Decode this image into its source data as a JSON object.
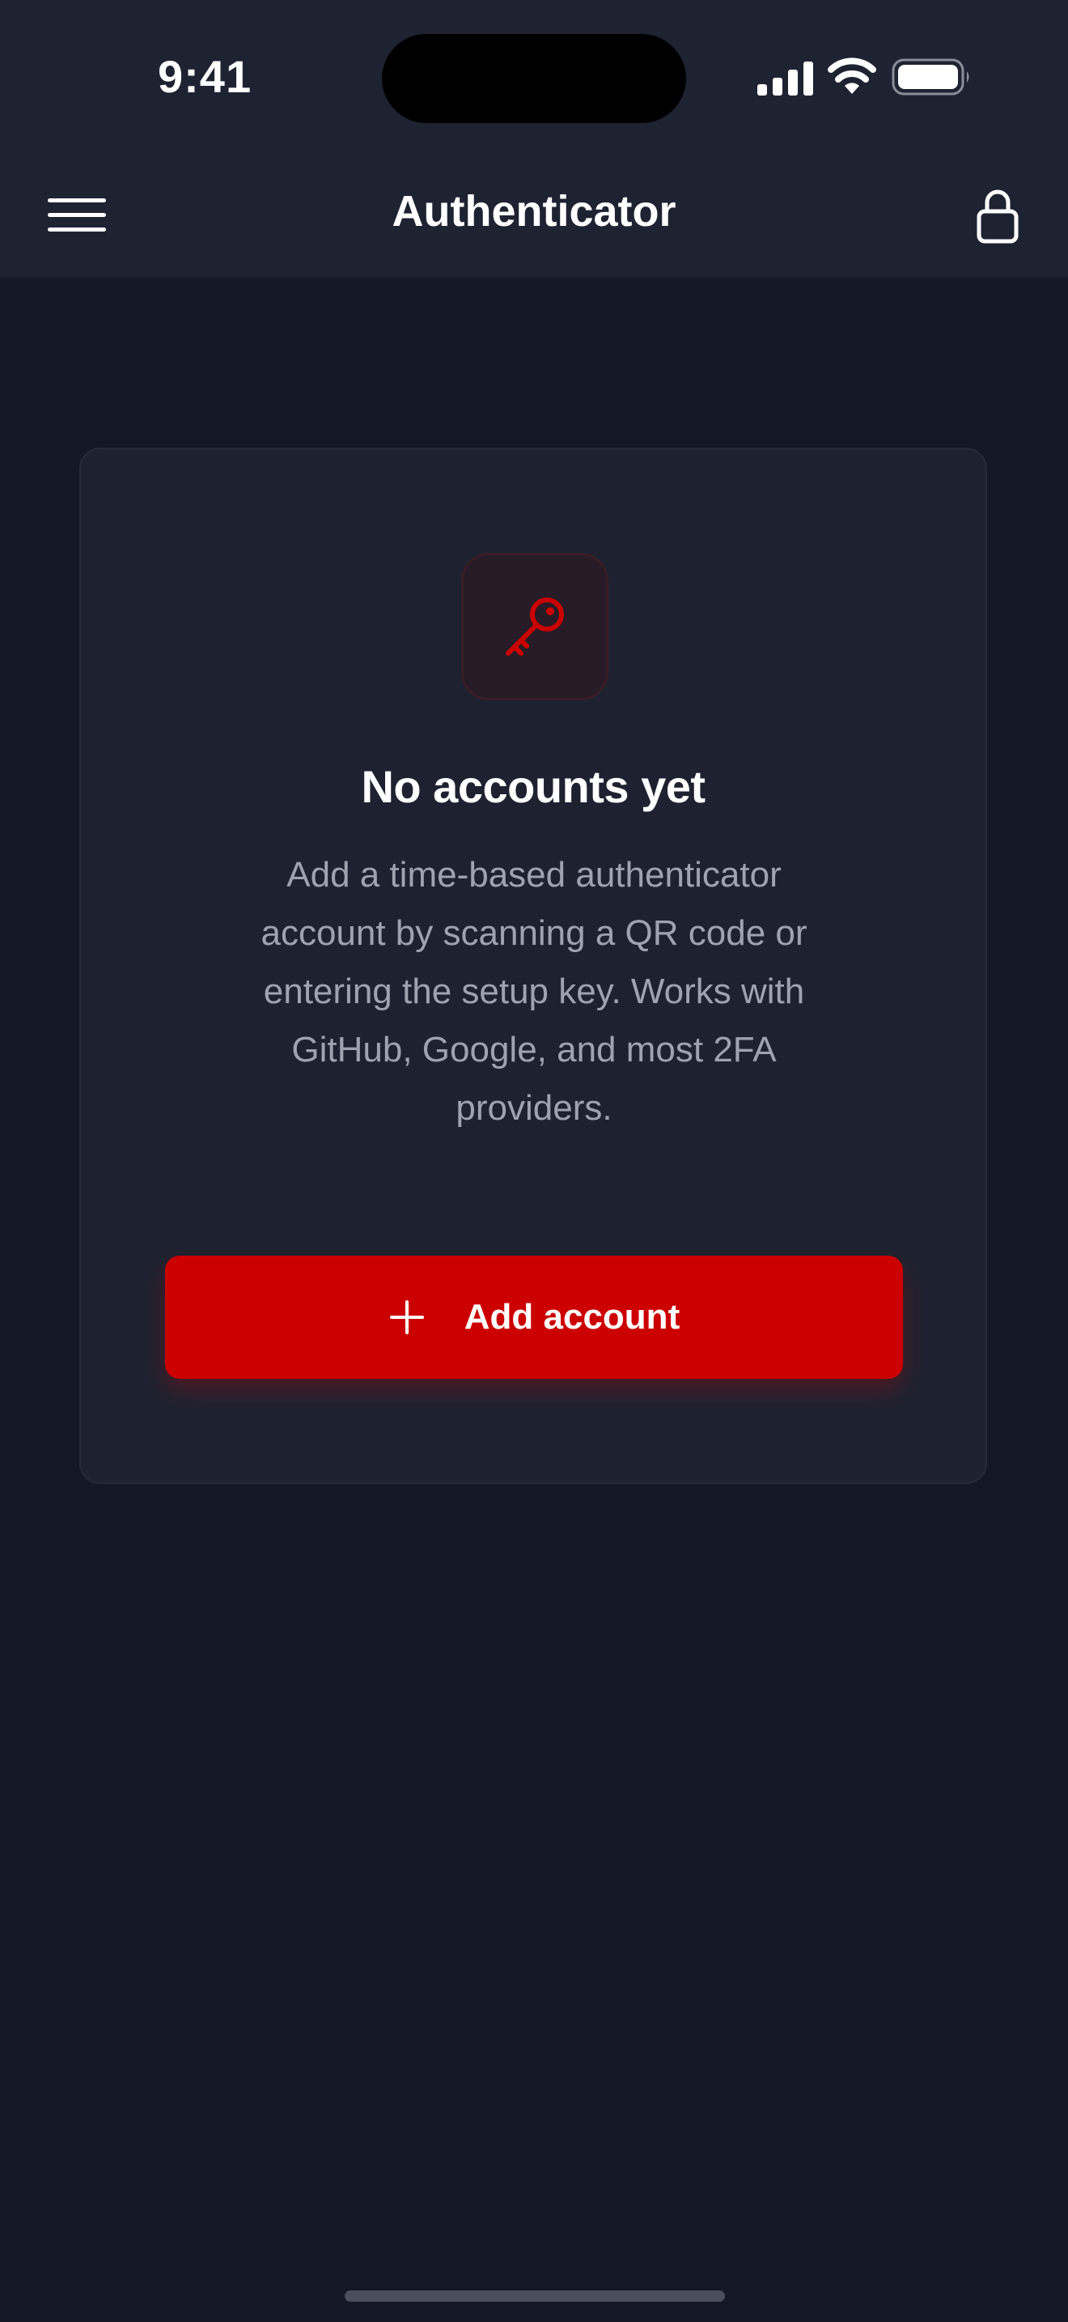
{
  "status_bar": {
    "time": "9:41"
  },
  "nav": {
    "title": "Authenticator"
  },
  "empty_state": {
    "title": "No accounts yet",
    "description": "Add a time-based authenticator account by scanning a QR code or entering the setup key. Works with GitHub, Google, and most 2FA providers.",
    "add_button_label": "Add account"
  },
  "icons": {
    "menu": "hamburger-menu-icon",
    "lock": "lock-icon",
    "key": "key-icon",
    "plus": "plus-icon"
  },
  "colors": {
    "accent": "#cc0000",
    "background": "#131827",
    "bar": "#1e2332",
    "card": "#1e2230"
  }
}
